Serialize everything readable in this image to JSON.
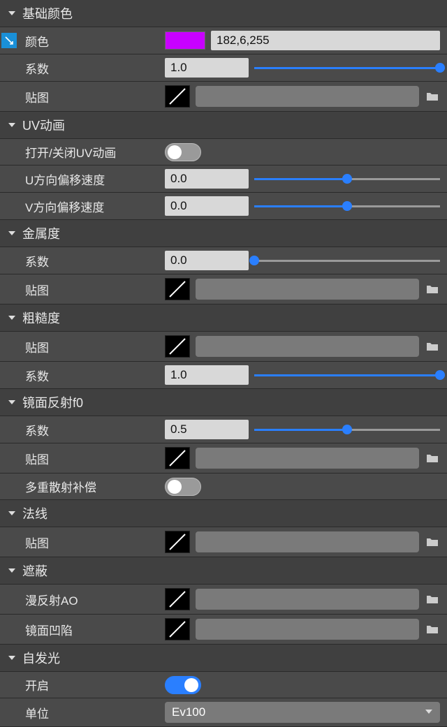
{
  "sections": {
    "base_color": {
      "title": "基础颜色"
    },
    "uv_anim": {
      "title": "UV动画"
    },
    "metallic": {
      "title": "金属度"
    },
    "roughness": {
      "title": "粗糙度"
    },
    "specular_f0": {
      "title": "镜面反射f0"
    },
    "normal": {
      "title": "法线"
    },
    "occlusion": {
      "title": "遮蔽"
    },
    "emission": {
      "title": "自发光"
    }
  },
  "base_color": {
    "color_label": "颜色",
    "color_value": "182,6,255",
    "color_swatch": "#c800ff",
    "factor_label": "系数",
    "factor_value": "1.0",
    "factor_percent": 100,
    "map_label": "贴图"
  },
  "uv_anim": {
    "toggle_label": "打开/关闭UV动画",
    "toggle_on": false,
    "u_label": "U方向偏移速度",
    "u_value": "0.0",
    "u_percent": 50,
    "v_label": "V方向偏移速度",
    "v_value": "0.0",
    "v_percent": 50
  },
  "metallic": {
    "factor_label": "系数",
    "factor_value": "0.0",
    "factor_percent": 0,
    "map_label": "贴图"
  },
  "roughness": {
    "map_label": "贴图",
    "factor_label": "系数",
    "factor_value": "1.0",
    "factor_percent": 100
  },
  "specular_f0": {
    "factor_label": "系数",
    "factor_value": "0.5",
    "factor_percent": 50,
    "map_label": "贴图",
    "ms_comp_label": "多重散射补偿",
    "ms_comp_on": false
  },
  "normal": {
    "map_label": "贴图"
  },
  "occlusion": {
    "diffuse_ao_label": "漫反射AO",
    "spec_occ_label": "镜面凹陷"
  },
  "emission": {
    "enable_label": "开启",
    "enable_on": true,
    "unit_label": "单位",
    "unit_value": "Ev100"
  }
}
